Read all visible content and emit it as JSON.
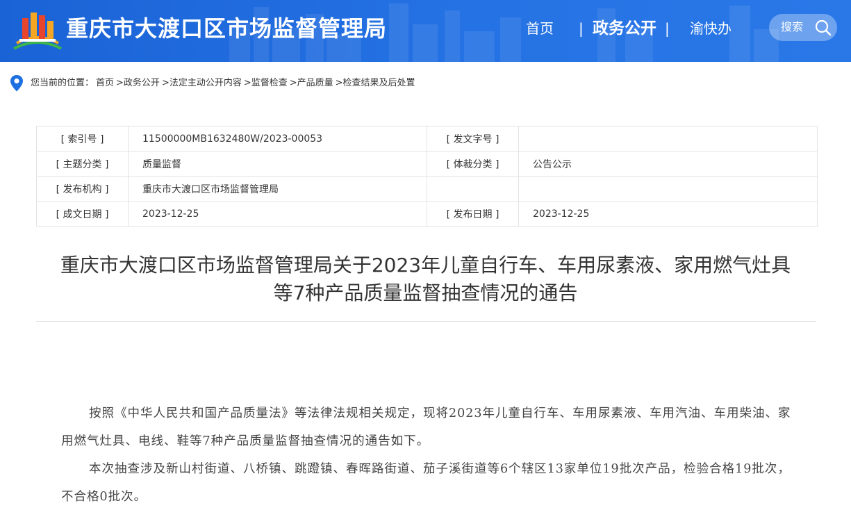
{
  "header": {
    "site_title": "重庆市大渡口区市场监督管理局",
    "nav": {
      "home": "首页",
      "separator": "|",
      "gov_open": "政务公开",
      "yu_kuai_ban": "渝快办"
    },
    "search_label": "搜索"
  },
  "breadcrumb": {
    "prefix": "您当前的位置：",
    "items": [
      "首页",
      ">政务公开",
      ">法定主动公开内容",
      ">监督检查",
      ">产品质量",
      ">检查结果及后处置"
    ]
  },
  "meta": {
    "index_no_label": "[ 索引号 ]",
    "index_no": "11500000MB1632480W/2023-00053",
    "doc_no_label": "[ 发文字号 ]",
    "doc_no": "",
    "topic_label": "[ 主题分类 ]",
    "topic": "质量监督",
    "genre_label": "[ 体裁分类 ]",
    "genre": "公告公示",
    "issuer_label": "[ 发布机构 ]",
    "issuer": "重庆市大渡口区市场监督管理局",
    "created_label": "[ 成文日期 ]",
    "created": "2023-12-25",
    "published_label": "[ 发布日期 ]",
    "published": "2023-12-25"
  },
  "article": {
    "title_line1": "重庆市大渡口区市场监督管理局关于2023年儿童自行车、车用尿素液、家用燃气灶具",
    "title_line2": "等7种产品质量监督抽查情况的通告",
    "paragraphs": [
      "按照《中华人民共和国产品质量法》等法律法规相关规定，现将2023年儿童自行车、车用尿素液、车用汽油、车用柴油、家用燃气灶具、电线、鞋等7种产品质量监督抽查情况的通告如下。",
      "本次抽查涉及新山村街道、八桥镇、跳蹬镇、春晖路街道、茄子溪街道等6个辖区13家单位19批次产品，检验合格19批次，不合格0批次。"
    ]
  },
  "colors": {
    "header_blue": "#2471e3",
    "logo_red": "#e8452c",
    "logo_orange": "#f5a623",
    "logo_green": "#3cb54a"
  },
  "icons": {
    "location": "location-pin-icon",
    "search": "search-icon"
  }
}
